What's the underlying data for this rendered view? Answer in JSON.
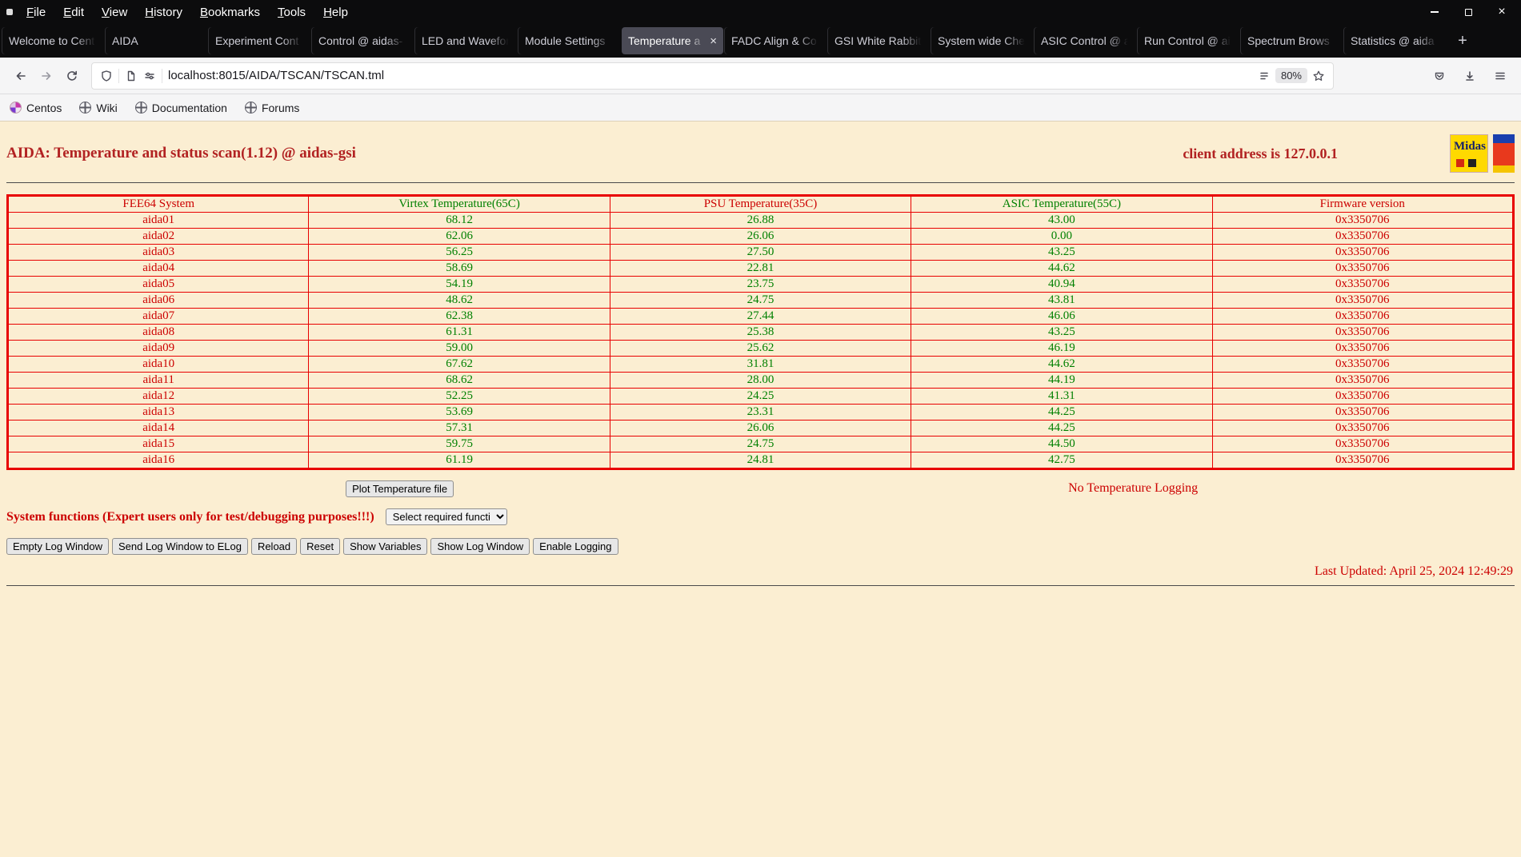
{
  "colors": {
    "page-bg": "#fbeed2",
    "page-red": "#cc0000",
    "title-red": "#b22222",
    "page-green": "#008000",
    "table-border": "#e80000"
  },
  "icons": {
    "window_close": "×",
    "tab_close": "×",
    "new_tab": "+"
  },
  "browser": {
    "menu": [
      "File",
      "Edit",
      "View",
      "History",
      "Bookmarks",
      "Tools",
      "Help"
    ],
    "tabs": [
      {
        "label": "Welcome to Cent",
        "active": false
      },
      {
        "label": "AIDA",
        "active": false
      },
      {
        "label": "Experiment Cont",
        "active": false
      },
      {
        "label": "Control @ aidas-",
        "active": false
      },
      {
        "label": "LED and Wavefor",
        "active": false
      },
      {
        "label": "Module Settings",
        "active": false
      },
      {
        "label": "Temperature a",
        "active": true
      },
      {
        "label": "FADC Align & Co",
        "active": false
      },
      {
        "label": "GSI White Rabbit",
        "active": false
      },
      {
        "label": "System wide Che",
        "active": false
      },
      {
        "label": "ASIC Control @ a",
        "active": false
      },
      {
        "label": "Run Control @ ai",
        "active": false
      },
      {
        "label": "Spectrum Brows",
        "active": false
      },
      {
        "label": "Statistics @ aida",
        "active": false
      }
    ],
    "nav": {
      "url": "localhost:8015/AIDA/TSCAN/TSCAN.tml",
      "zoom": "80%"
    },
    "bookmarks": [
      {
        "label": "Centos",
        "icon": "centos"
      },
      {
        "label": "Wiki",
        "icon": "globe"
      },
      {
        "label": "Documentation",
        "icon": "globe"
      },
      {
        "label": "Forums",
        "icon": "globe"
      }
    ]
  },
  "page": {
    "title": "AIDA: Temperature and status scan(1.12) @ aidas-gsi",
    "client_address": "client address is 127.0.0.1",
    "logos": {
      "midas_text": "Midas"
    },
    "table": {
      "headers": [
        {
          "label": "FEE64 System",
          "color": "red"
        },
        {
          "label": "Virtex Temperature(65C)",
          "color": "green"
        },
        {
          "label": "PSU Temperature(35C)",
          "color": "red"
        },
        {
          "label": "ASIC Temperature(55C)",
          "color": "green"
        },
        {
          "label": "Firmware version",
          "color": "red"
        }
      ],
      "rows": [
        {
          "name": "aida01",
          "virtex": "68.12",
          "psu": "26.88",
          "asic": "43.00",
          "firmware": "0x3350706"
        },
        {
          "name": "aida02",
          "virtex": "62.06",
          "psu": "26.06",
          "asic": "0.00",
          "firmware": "0x3350706"
        },
        {
          "name": "aida03",
          "virtex": "56.25",
          "psu": "27.50",
          "asic": "43.25",
          "firmware": "0x3350706"
        },
        {
          "name": "aida04",
          "virtex": "58.69",
          "psu": "22.81",
          "asic": "44.62",
          "firmware": "0x3350706"
        },
        {
          "name": "aida05",
          "virtex": "54.19",
          "psu": "23.75",
          "asic": "40.94",
          "firmware": "0x3350706"
        },
        {
          "name": "aida06",
          "virtex": "48.62",
          "psu": "24.75",
          "asic": "43.81",
          "firmware": "0x3350706"
        },
        {
          "name": "aida07",
          "virtex": "62.38",
          "psu": "27.44",
          "asic": "46.06",
          "firmware": "0x3350706"
        },
        {
          "name": "aida08",
          "virtex": "61.31",
          "psu": "25.38",
          "asic": "43.25",
          "firmware": "0x3350706"
        },
        {
          "name": "aida09",
          "virtex": "59.00",
          "psu": "25.62",
          "asic": "46.19",
          "firmware": "0x3350706"
        },
        {
          "name": "aida10",
          "virtex": "67.62",
          "psu": "31.81",
          "asic": "44.62",
          "firmware": "0x3350706"
        },
        {
          "name": "aida11",
          "virtex": "68.62",
          "psu": "28.00",
          "asic": "44.19",
          "firmware": "0x3350706"
        },
        {
          "name": "aida12",
          "virtex": "52.25",
          "psu": "24.25",
          "asic": "41.31",
          "firmware": "0x3350706"
        },
        {
          "name": "aida13",
          "virtex": "53.69",
          "psu": "23.31",
          "asic": "44.25",
          "firmware": "0x3350706"
        },
        {
          "name": "aida14",
          "virtex": "57.31",
          "psu": "26.06",
          "asic": "44.25",
          "firmware": "0x3350706"
        },
        {
          "name": "aida15",
          "virtex": "59.75",
          "psu": "24.75",
          "asic": "44.50",
          "firmware": "0x3350706"
        },
        {
          "name": "aida16",
          "virtex": "61.19",
          "psu": "24.81",
          "asic": "42.75",
          "firmware": "0x3350706"
        }
      ]
    },
    "plot_button_label": "Plot Temperature file",
    "logging_status": "No Temperature Logging",
    "system_functions_label": "System functions (Expert users only for test/debugging purposes!!!)",
    "function_select_value": "Select required function",
    "action_buttons": [
      "Empty Log Window",
      "Send Log Window to ELog",
      "Reload",
      "Reset",
      "Show Variables",
      "Show Log Window",
      "Enable Logging"
    ],
    "last_updated": "Last Updated: April 25, 2024 12:49:29"
  }
}
